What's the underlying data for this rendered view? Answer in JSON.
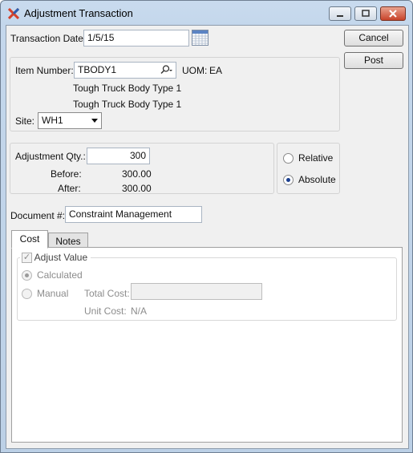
{
  "window": {
    "title": "Adjustment Transaction"
  },
  "form": {
    "transaction_date_label": "Transaction Date:",
    "transaction_date_value": "1/5/15",
    "item_number_label": "Item Number:",
    "item_number_value": "TBODY1",
    "uom_label": "UOM:",
    "uom_value": "EA",
    "item_desc1": "Tough Truck Body Type 1",
    "item_desc2": "Tough Truck Body Type 1",
    "site_label": "Site:",
    "site_value": "WH1",
    "adj_qty_label": "Adjustment Qty.:",
    "adj_qty_value": "300",
    "before_label": "Before:",
    "before_value": "300.00",
    "after_label": "After:",
    "after_value": "300.00",
    "mode_relative_label": "Relative",
    "mode_absolute_label": "Absolute",
    "document_label": "Document #:",
    "document_value": "Constraint Management"
  },
  "buttons": {
    "cancel": "Cancel",
    "post": "Post"
  },
  "tabs": [
    {
      "label": "Cost",
      "active": true
    },
    {
      "label": "Notes",
      "active": false
    }
  ],
  "cost": {
    "adjust_value_label": "Adjust Value",
    "calculated_label": "Calculated",
    "manual_label": "Manual",
    "total_cost_label": "Total Cost:",
    "total_cost_value": "",
    "unit_cost_label": "Unit Cost:",
    "unit_cost_value": "N/A"
  }
}
